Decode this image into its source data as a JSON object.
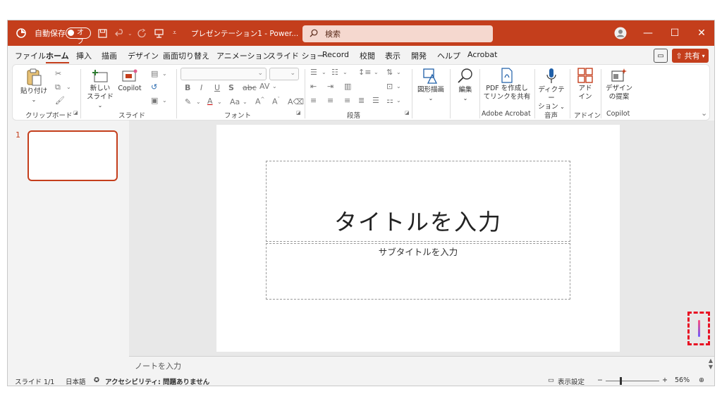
{
  "titlebar": {
    "autosave_label": "自動保存",
    "autosave_state": "オフ",
    "doc_title": "プレゼンテーション1 - Power...",
    "search_placeholder": "検索"
  },
  "menu": {
    "tabs": [
      "ファイル",
      "ホーム",
      "挿入",
      "描画",
      "デザイン",
      "画面切り替え",
      "アニメーション",
      "スライド ショー",
      "Record",
      "校閲",
      "表示",
      "開発",
      "ヘルプ",
      "Acrobat"
    ],
    "active": "ホーム",
    "share_label": "共有"
  },
  "ribbon": {
    "clipboard": {
      "paste": "貼り付け",
      "label": "クリップボード"
    },
    "slides": {
      "new_slide_1": "新しい",
      "new_slide_2": "スライド",
      "copilot": "Copilot",
      "label": "スライド"
    },
    "font": {
      "label": "フォント"
    },
    "paragraph": {
      "label": "段落"
    },
    "drawing": {
      "shapes": "図形描画"
    },
    "editing": {
      "edit": "編集"
    },
    "acrobat": {
      "pdf_1": "PDF を作成し",
      "pdf_2": "てリンクを共有",
      "label": "Adobe Acrobat"
    },
    "voice": {
      "dictate_1": "ディクテー",
      "dictate_2": "ション",
      "label": "音声"
    },
    "addins": {
      "addin_1": "アド",
      "addin_2": "イン",
      "label": "アドイン"
    },
    "copilot": {
      "design_1": "デザイン",
      "design_2": "の提案",
      "label": "Copilot"
    }
  },
  "slides_panel": {
    "number": "1"
  },
  "slide": {
    "title_placeholder": "タイトルを入力",
    "subtitle_placeholder": "サブタイトルを入力"
  },
  "notes": {
    "placeholder": "ノートを入力"
  },
  "status": {
    "slide_pos": "スライド 1/1",
    "language": "日本語",
    "accessibility": "アクセシビリティ: 問題ありません",
    "display_settings": "表示設定",
    "zoom": "56%"
  },
  "colors": {
    "accent": "#c43e1c",
    "highlight": "#e81123"
  }
}
